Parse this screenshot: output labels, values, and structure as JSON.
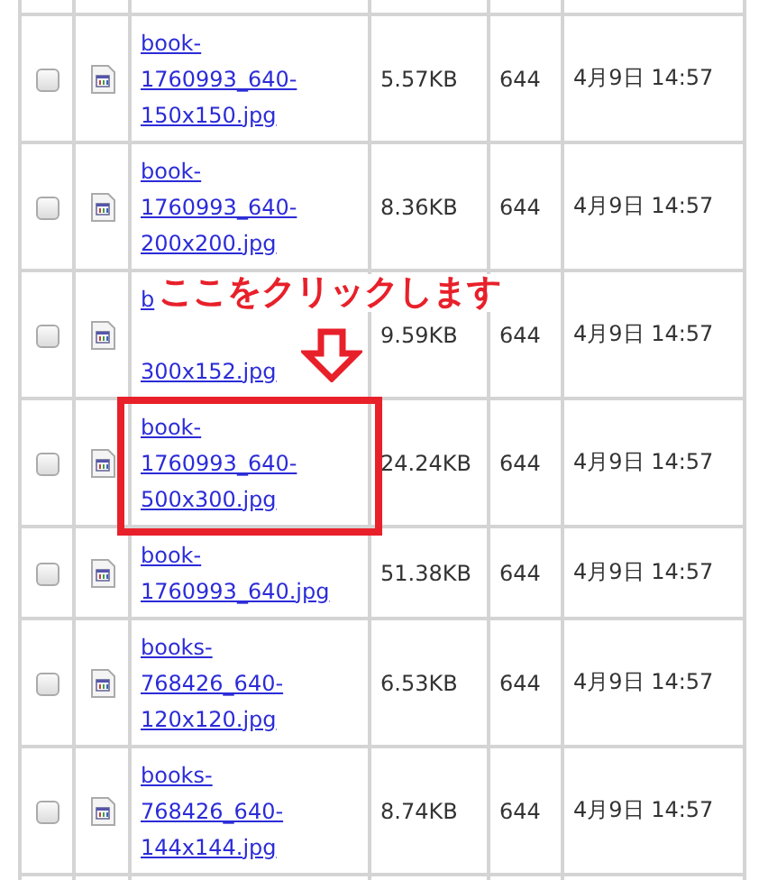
{
  "files": [
    {
      "checked": false,
      "name": "book-1760993_640-150x150.jpg",
      "size": "5.57KB",
      "permission": "644",
      "modified": "4月9日 14:57",
      "highlighted": false
    },
    {
      "checked": false,
      "name": "book-1760993_640-200x200.jpg",
      "size": "8.36KB",
      "permission": "644",
      "modified": "4月9日 14:57",
      "highlighted": false
    },
    {
      "checked": false,
      "name_parts": [
        "b",
        "300x152.jpg"
      ],
      "size": "9.59KB",
      "permission": "644",
      "modified": "4月9日 14:57",
      "highlighted": false
    },
    {
      "checked": false,
      "name": "book-1760993_640-500x300.jpg",
      "size": "24.24KB",
      "permission": "644",
      "modified": "4月9日 14:57",
      "highlighted": true
    },
    {
      "checked": false,
      "name": "book-1760993_640.jpg",
      "size": "51.38KB",
      "permission": "644",
      "modified": "4月9日 14:57",
      "highlighted": false
    },
    {
      "checked": false,
      "name": "books-768426_640-120x120.jpg",
      "size": "6.53KB",
      "permission": "644",
      "modified": "4月9日 14:57",
      "highlighted": false
    },
    {
      "checked": false,
      "name": "books-768426_640-144x144.jpg",
      "size": "8.74KB",
      "permission": "644",
      "modified": "4月9日 14:57",
      "highlighted": false
    }
  ],
  "annotation": {
    "label": "ここをクリックします"
  }
}
